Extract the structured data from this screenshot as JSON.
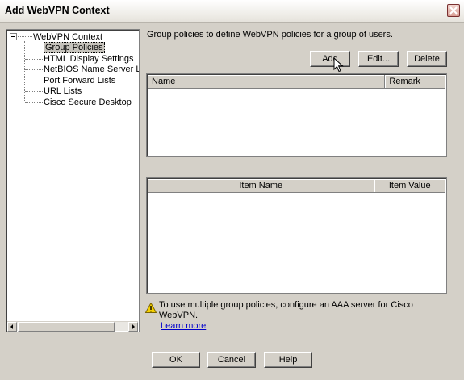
{
  "window": {
    "title": "Add WebVPN Context"
  },
  "tree": {
    "root_label": "WebVPN Context",
    "items": [
      {
        "label": "Group Policies",
        "selected": true
      },
      {
        "label": "HTML Display Settings",
        "selected": false
      },
      {
        "label": "NetBIOS Name Server Lis",
        "selected": false
      },
      {
        "label": "Port Forward Lists",
        "selected": false
      },
      {
        "label": "URL Lists",
        "selected": false
      },
      {
        "label": "Cisco Secure Desktop",
        "selected": false
      }
    ]
  },
  "main": {
    "description": "Group policies to define WebVPN policies for a group of users.",
    "actions": {
      "add": "Add",
      "edit": "Edit...",
      "delete": "Delete"
    },
    "policy_table": {
      "columns": [
        "Name",
        "Remark"
      ],
      "rows": []
    },
    "item_table": {
      "columns": [
        "Item Name",
        "Item Value"
      ],
      "rows": []
    },
    "warning": {
      "icon": "warning-icon",
      "text": "To use multiple group policies, configure an AAA server for Cisco WebVPN.",
      "link": "Learn more"
    }
  },
  "footer": {
    "ok": "OK",
    "cancel": "Cancel",
    "help": "Help"
  }
}
